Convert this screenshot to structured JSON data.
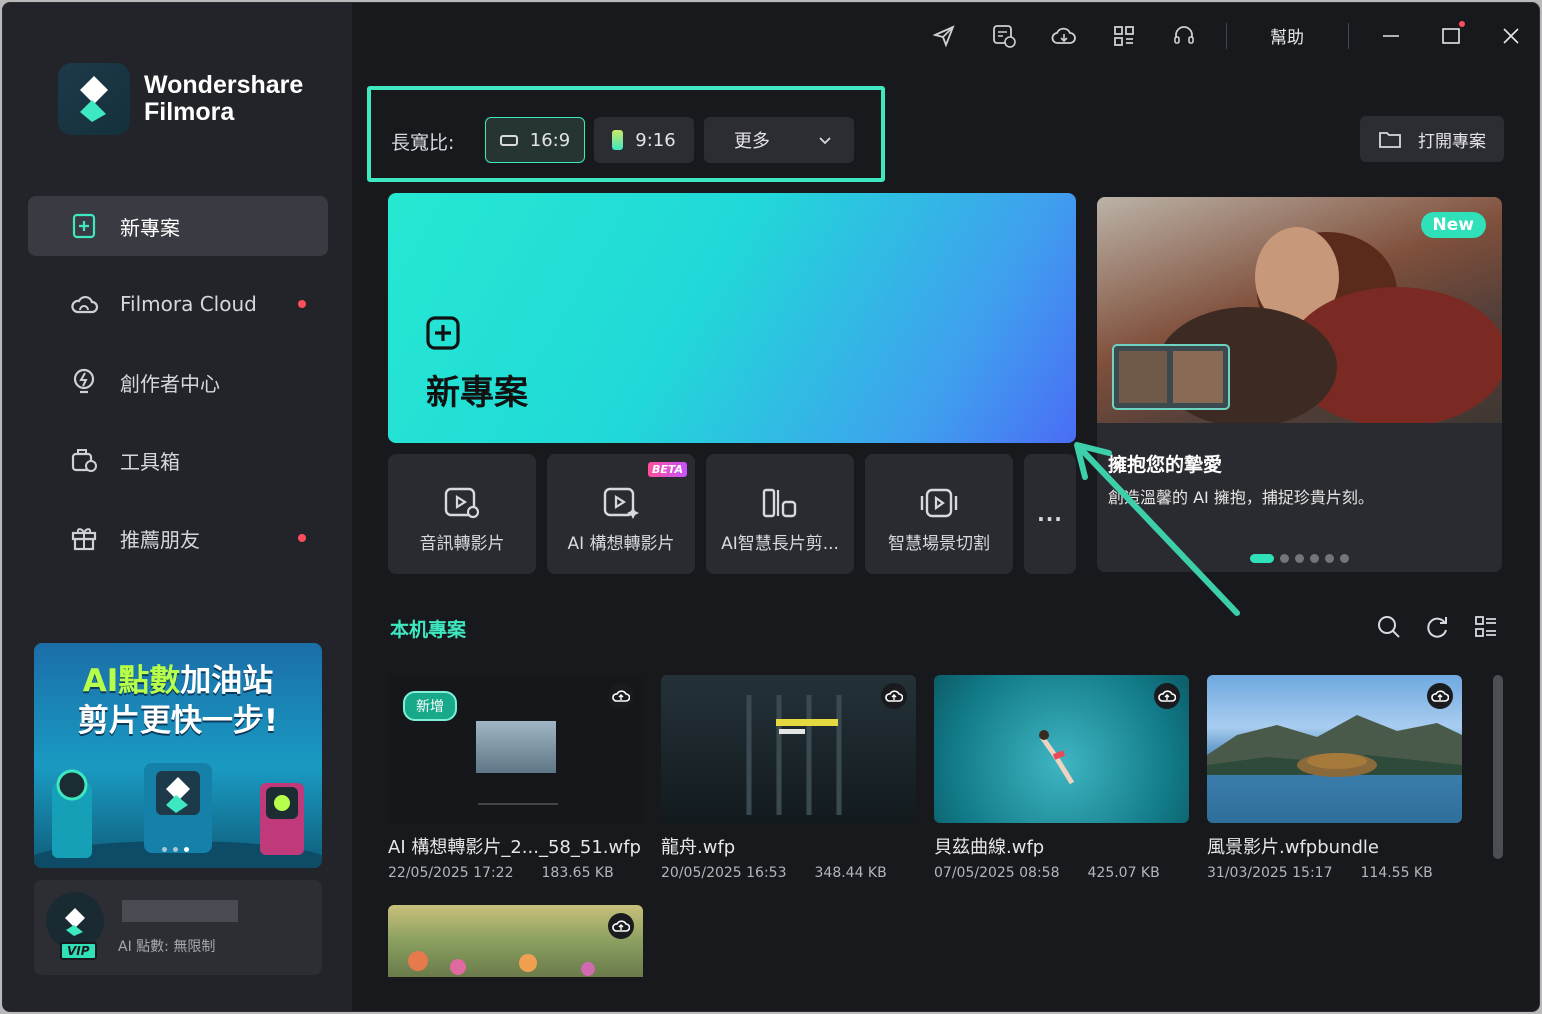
{
  "app": {
    "brand_line1": "Wondershare",
    "brand_line2": "Filmora"
  },
  "sidebar": {
    "items": [
      {
        "label": "新專案",
        "icon": "new-project-icon",
        "active": true
      },
      {
        "label": "Filmora Cloud",
        "icon": "cloud-icon",
        "badge": true
      },
      {
        "label": "創作者中心",
        "icon": "lightbulb-icon"
      },
      {
        "label": "工具箱",
        "icon": "toolbox-icon"
      },
      {
        "label": "推薦朋友",
        "icon": "gift-icon",
        "badge": true
      }
    ],
    "promo": {
      "title_hl": "AI點數",
      "title_rest": "加油站",
      "title_line2": "剪片更快一步!"
    },
    "account": {
      "badge": "VIP",
      "credits": "AI 點數: 無限制"
    }
  },
  "topbar": {
    "help": "幫助",
    "icons": [
      "send-icon",
      "task-icon",
      "cloud-sync-icon",
      "apps-icon",
      "headset-icon"
    ]
  },
  "aspect": {
    "label": "長寬比:",
    "options": [
      "16:9",
      "9:16"
    ],
    "more": "更多",
    "selected": "16:9"
  },
  "open_project": "打開專案",
  "hero": {
    "title": "新專案"
  },
  "tools": [
    {
      "label": "音訊轉影片"
    },
    {
      "label": "AI 構想轉影片",
      "beta": "BETA"
    },
    {
      "label": "AI智慧長片剪..."
    },
    {
      "label": "智慧場景切割"
    },
    {
      "label": "..."
    }
  ],
  "feature": {
    "badge": "New",
    "title": "擁抱您的摯愛",
    "desc": "創造溫馨的 AI 擁抱，捕捉珍貴片刻。"
  },
  "local": {
    "title": "本机專案",
    "projects": [
      {
        "name": "AI 構想轉影片_2..._58_51.wfp",
        "date": "22/05/2025 17:22",
        "size": "183.65 KB",
        "tag": "新增"
      },
      {
        "name": "龍舟.wfp",
        "date": "20/05/2025 16:53",
        "size": "348.44 KB"
      },
      {
        "name": "貝茲曲線.wfp",
        "date": "07/05/2025 08:58",
        "size": "425.07 KB"
      },
      {
        "name": "風景影片.wfpbundle",
        "date": "31/03/2025 15:17",
        "size": "114.55 KB"
      }
    ]
  },
  "colors": {
    "accent": "#3ee8c0",
    "badge": "#ff4d5e",
    "bg": "#18191d",
    "sidebar": "#232429"
  }
}
